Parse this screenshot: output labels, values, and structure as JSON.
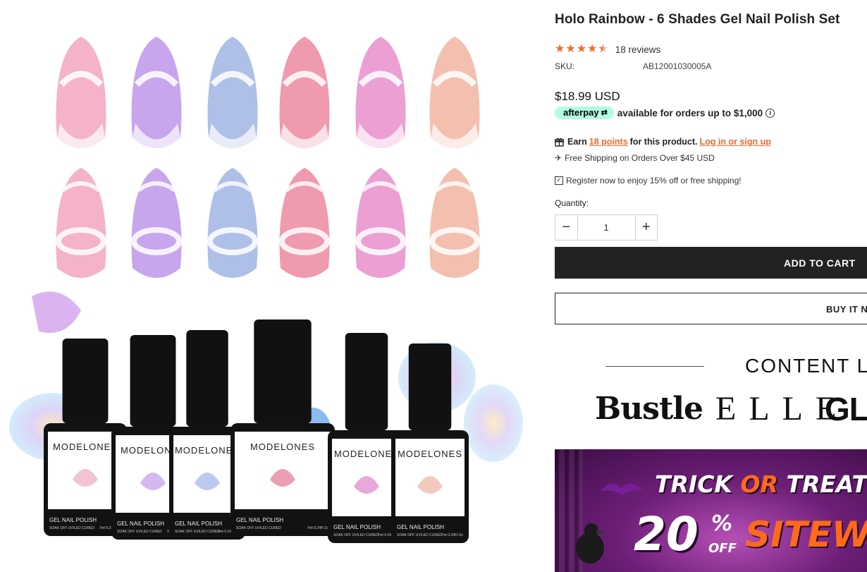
{
  "gallery": {
    "brand_on_bottle": "MODELONES",
    "bottle_label": "GEL NAIL POLISH",
    "bottle_small": "SOAK OFF UV/LED CURED",
    "bottle_volume": "7ml·0.24Fl.Oz",
    "nail_colors": [
      "#f4b3c9",
      "#c7a6ee",
      "#aebfe8",
      "#ef9aae",
      "#ec9fd3",
      "#f3c0b0"
    ],
    "bottle_tint": [
      "#f2c3d5",
      "#d4b8ef",
      "#bcc9ee",
      "#ec9fb4",
      "#e9a8d9",
      "#f2c9bd"
    ]
  },
  "product": {
    "title": "Holo Rainbow - 6 Shades Gel Nail Polish Set",
    "rating": 4.5,
    "reviews": "18 reviews",
    "sku_label": "SKU:",
    "sku_value": "AB12001030005A",
    "price": "$18.99 USD"
  },
  "afterpay": {
    "badge": "afterpay",
    "text": "available for orders up to $1,000"
  },
  "rewards": {
    "earn": "Earn",
    "points": "18 points",
    "suffix": "for this product.",
    "login": "Log in or sign up"
  },
  "shipping": "Free Shipping on Orders Over $45 USD",
  "register": "Register now to enjoy 15% off or free shipping!",
  "quantity": {
    "label": "Quantity:",
    "value": "1"
  },
  "buttons": {
    "add_to_cart": "ADD TO CART",
    "buy_now": "BUY IT N"
  },
  "press": {
    "heading": "CONTENT L",
    "logos": [
      "Bustle",
      "ELLE",
      "GLA"
    ]
  },
  "banner": {
    "trick": "TRICK",
    "or": "OR",
    "treat": "TREAT",
    "percent": "20",
    "pct_sign": "%",
    "off": "OFF",
    "sitewide": "SITEWI"
  },
  "colors": {
    "accent": "#ee6a2f",
    "button_dark": "#222222",
    "afterpay_mint": "#b2fce4"
  }
}
